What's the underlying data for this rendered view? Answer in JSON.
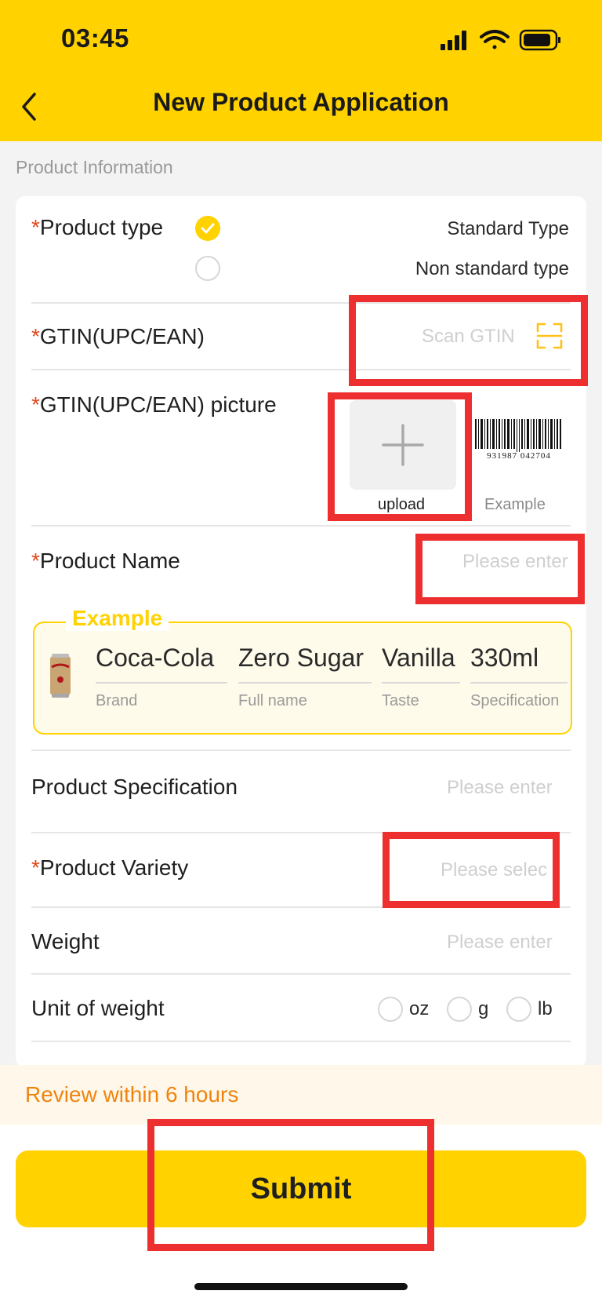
{
  "status_bar": {
    "time": "03:45"
  },
  "header": {
    "title": "New Product Application"
  },
  "section": {
    "label": "Product Information"
  },
  "required_mark": "*",
  "product_type": {
    "label": "Product type",
    "options": [
      {
        "label": "Standard Type",
        "selected": true
      },
      {
        "label": "Non standard type",
        "selected": false
      }
    ]
  },
  "gtin": {
    "label": "GTIN(UPC/EAN)",
    "placeholder": "Scan GTIN"
  },
  "gtin_picture": {
    "label": "GTIN(UPC/EAN) picture",
    "upload_label": "upload",
    "example_label": "Example",
    "barcode_digits": "931987 042704"
  },
  "product_name": {
    "label": "Product Name",
    "placeholder": "Please enter"
  },
  "example_card": {
    "title": "Example",
    "fields": [
      {
        "value": "Coca-Cola",
        "caption": "Brand"
      },
      {
        "value": "Zero Sugar",
        "caption": "Full name"
      },
      {
        "value": "Vanilla",
        "caption": "Taste"
      },
      {
        "value": "330ml",
        "caption": "Specification"
      }
    ]
  },
  "product_specification": {
    "label": "Product Specification",
    "placeholder": "Please enter"
  },
  "product_variety": {
    "label": "Product Variety",
    "placeholder": "Please selec"
  },
  "weight": {
    "label": "Weight",
    "placeholder": "Please enter"
  },
  "unit_of_weight": {
    "label": "Unit of weight",
    "options": [
      "oz",
      "g",
      "lb"
    ]
  },
  "notice": {
    "text": "Review within 6 hours"
  },
  "submit": {
    "label": "Submit"
  },
  "colors": {
    "brand": "#ffd200",
    "required": "#e0481f",
    "notice": "#f0830e",
    "highlight": "#ee2f2f"
  }
}
